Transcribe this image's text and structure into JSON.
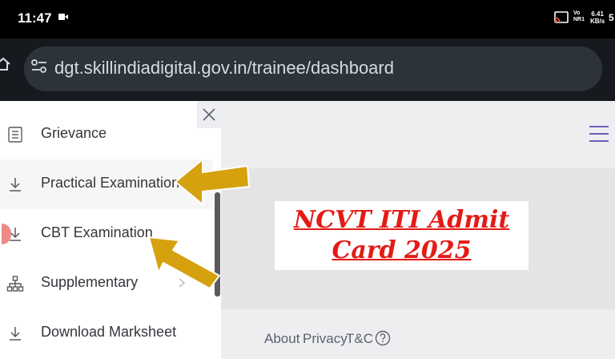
{
  "status_bar": {
    "time": "11:47",
    "network_line1": "Vo",
    "network_line2": "NR1",
    "speed_value": "6.41",
    "speed_unit": "KB/s",
    "battery": "5"
  },
  "browser": {
    "url": "dgt.skillindiadigital.gov.in/trainee/dashboard"
  },
  "drawer": {
    "items": [
      {
        "label": "Grievance",
        "icon": "list-icon"
      },
      {
        "label": "Practical Examination",
        "icon": "download-icon"
      },
      {
        "label": "CBT Examination",
        "icon": "download-icon"
      },
      {
        "label": "Supplementary",
        "icon": "hierarchy-icon"
      },
      {
        "label": "Download Marksheet",
        "icon": "download-icon"
      }
    ]
  },
  "banner": {
    "line1": "NCVT ITI Admit",
    "line2": "Card 2025"
  },
  "footer": {
    "about": "About",
    "privacy": "Privacy",
    "tc": "T&C"
  },
  "colors": {
    "arrow": "#d6a10f",
    "banner_text": "#e31b16"
  }
}
